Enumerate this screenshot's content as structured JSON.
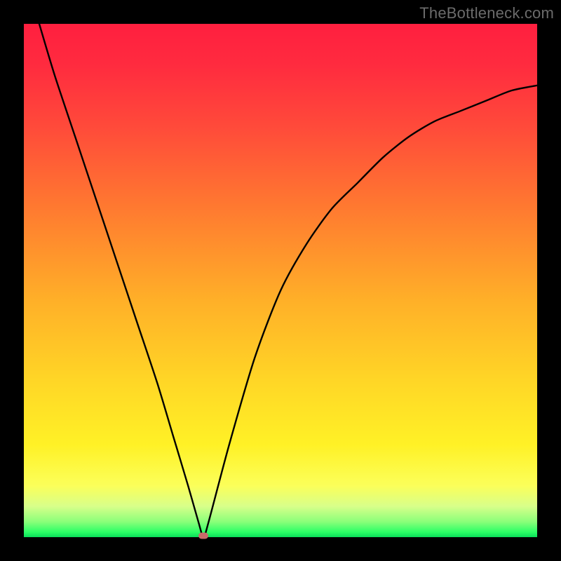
{
  "attribution": "TheBottleneck.com",
  "colors": {
    "gradient_top": "#ff1f3f",
    "gradient_bottom": "#0adf5a",
    "curve": "#000000",
    "marker": "#c86a6a",
    "frame": "#000000",
    "attribution_text": "#6b6b6b"
  },
  "chart_data": {
    "type": "line",
    "title": "",
    "xlabel": "",
    "ylabel": "",
    "xlim": [
      0,
      100
    ],
    "ylim": [
      0,
      100
    ],
    "grid": false,
    "legend": false,
    "series": [
      {
        "name": "curve",
        "x": [
          3,
          6,
          10,
          14,
          18,
          22,
          26,
          29,
          32,
          34,
          35,
          36,
          40,
          45,
          50,
          55,
          60,
          65,
          70,
          75,
          80,
          85,
          90,
          95,
          100
        ],
        "y": [
          100,
          90,
          78,
          66,
          54,
          42,
          30,
          20,
          10,
          3,
          0,
          3,
          18,
          35,
          48,
          57,
          64,
          69,
          74,
          78,
          81,
          83,
          85,
          87,
          88
        ]
      }
    ],
    "annotations": [
      {
        "name": "min-marker",
        "x": 35,
        "y": 0
      }
    ],
    "background_gradient": {
      "direction": "vertical",
      "stops": [
        {
          "pos": 0.0,
          "color": "#ff1f3f"
        },
        {
          "pos": 0.36,
          "color": "#ff7a30"
        },
        {
          "pos": 0.7,
          "color": "#ffd726"
        },
        {
          "pos": 0.9,
          "color": "#fbff5a"
        },
        {
          "pos": 1.0,
          "color": "#0adf5a"
        }
      ]
    }
  }
}
